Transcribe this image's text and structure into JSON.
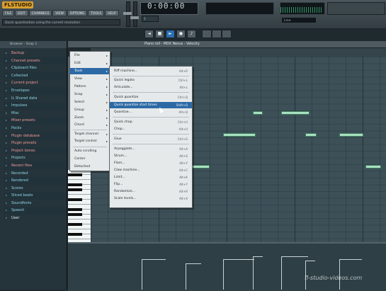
{
  "app": {
    "logo": "FLSTUDIO"
  },
  "menubar": [
    "FILE",
    "EDIT",
    "CHANNELS",
    "VIEW",
    "OPTIONS",
    "TOOLS",
    "HELP"
  ],
  "hint": "Quick quantization using the current resolution",
  "transport": {
    "time": "0:00:00",
    "pattern": "1",
    "tempo": "Line",
    "buttons": [
      "◄",
      "■",
      "►",
      "●",
      "♪"
    ]
  },
  "browser": {
    "title": "Browser - Snap 1",
    "items": [
      {
        "label": "Backup"
      },
      {
        "label": "Channel presets"
      },
      {
        "label": "Clipboard files"
      },
      {
        "label": "Collected"
      },
      {
        "label": "Current project"
      },
      {
        "label": "Envelopes"
      },
      {
        "label": "IL Shared data"
      },
      {
        "label": "Impulses"
      },
      {
        "label": "Misc"
      },
      {
        "label": "Mixer presets"
      },
      {
        "label": "Packs"
      },
      {
        "label": "Plugin database"
      },
      {
        "label": "Plugin presets"
      },
      {
        "label": "Project bones"
      },
      {
        "label": "Projects"
      },
      {
        "label": "Recent files"
      },
      {
        "label": "Recorded"
      },
      {
        "label": "Rendered"
      },
      {
        "label": "Scores"
      },
      {
        "label": "Sliced beats"
      },
      {
        "label": "Soundfonts"
      },
      {
        "label": "Speech"
      },
      {
        "label": "User"
      }
    ]
  },
  "piano_roll": {
    "title": "Piano roll - MDX Nexus - Velocity"
  },
  "menu1": {
    "items": [
      "File",
      "Edit",
      "Tools",
      "View",
      "Pattern",
      "Snap",
      "Select",
      "Group",
      "Zoom",
      "Chord",
      "Target channel",
      "Target control",
      "Auto scrolling",
      "Center",
      "Detached"
    ]
  },
  "menu2": {
    "items": [
      {
        "label": "Riff machine...",
        "shortcut": "Alt+R"
      },
      {
        "label": "Quick legato",
        "shortcut": "Ctrl+L"
      },
      {
        "label": "Articulate...",
        "shortcut": "Alt+L"
      },
      {
        "label": "Quick quantize",
        "shortcut": "Ctrl+Q"
      },
      {
        "label": "Quick quantize start times",
        "shortcut": "Shift+Q"
      },
      {
        "label": "Quantize...",
        "shortcut": "Alt+Q"
      },
      {
        "label": "Quick chop",
        "shortcut": "Ctrl+U"
      },
      {
        "label": "Chop...",
        "shortcut": "Alt+U"
      },
      {
        "label": "Glue",
        "shortcut": "Ctrl+G"
      },
      {
        "label": "Arpeggiate...",
        "shortcut": "Alt+A"
      },
      {
        "label": "Strum...",
        "shortcut": "Alt+S"
      },
      {
        "label": "Flam...",
        "shortcut": "Alt+F"
      },
      {
        "label": "Claw machine...",
        "shortcut": "Alt+C"
      },
      {
        "label": "Limit...",
        "shortcut": "Alt+K"
      },
      {
        "label": "Flip...",
        "shortcut": "Alt+Y"
      },
      {
        "label": "Randomize...",
        "shortcut": "Alt+R"
      },
      {
        "label": "Scale levels...",
        "shortcut": "Alt+X"
      }
    ]
  },
  "watermark": "fl-studio-videos.com",
  "colors": {
    "note": "#a8e0c0",
    "menu_highlight": "#2d6aa5",
    "browser_text": "#8ed6e6",
    "accent_folder": "#f19a9a"
  }
}
